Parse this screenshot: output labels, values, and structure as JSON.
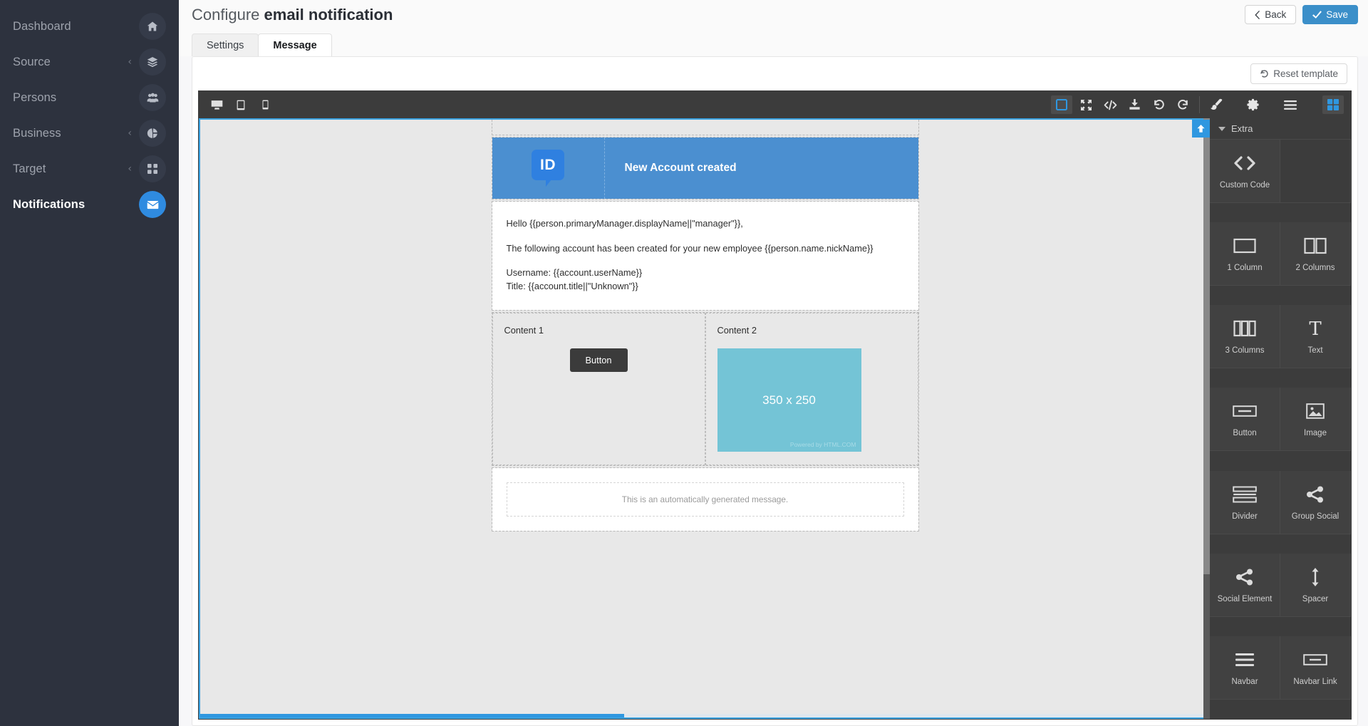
{
  "sidebar": {
    "items": [
      {
        "label": "Dashboard",
        "icon": "home-icon",
        "caret": false,
        "active": false
      },
      {
        "label": "Source",
        "icon": "layers-icon",
        "caret": true,
        "active": false
      },
      {
        "label": "Persons",
        "icon": "users-icon",
        "caret": false,
        "active": false
      },
      {
        "label": "Business",
        "icon": "pie-chart-icon",
        "caret": true,
        "active": false
      },
      {
        "label": "Target",
        "icon": "grid-icon",
        "caret": true,
        "active": false
      },
      {
        "label": "Notifications",
        "icon": "envelope-icon",
        "caret": false,
        "active": true
      }
    ],
    "caret_glyph": "‹",
    "active_color": "#2f8be0",
    "background": "#2d323e"
  },
  "header": {
    "title_prefix": "Configure ",
    "title_strong": "email notification",
    "back_label": "Back",
    "save_label": "Save",
    "save_color": "#3b8fc9"
  },
  "tabs": [
    {
      "label": "Settings",
      "active": false
    },
    {
      "label": "Message",
      "active": true
    }
  ],
  "card": {
    "reset_label": "Reset template"
  },
  "editor_toolbar": {
    "devices": [
      {
        "name": "desktop-view-icon",
        "active": false
      },
      {
        "name": "tablet-view-icon",
        "active": false
      },
      {
        "name": "mobile-view-icon",
        "active": false
      }
    ],
    "tools": [
      {
        "name": "borders-toggle-icon",
        "active": true
      },
      {
        "name": "fullscreen-icon",
        "active": false
      },
      {
        "name": "code-view-icon",
        "active": false
      },
      {
        "name": "import-icon",
        "active": false
      },
      {
        "name": "undo-icon",
        "active": false
      },
      {
        "name": "redo-icon",
        "active": false
      }
    ],
    "panels": [
      {
        "name": "paint-brush-icon",
        "active": false
      },
      {
        "name": "settings-gear-icon",
        "active": false
      },
      {
        "name": "layers-list-icon",
        "active": false
      },
      {
        "name": "blocks-icon",
        "active": true
      }
    ],
    "accent": "#2f97e0",
    "background": "#3c3c3c"
  },
  "email": {
    "header": {
      "logo_text": "ID",
      "title": "New Account created",
      "background": "#4b8fd0",
      "logo_color": "#2f80e0"
    },
    "body_lines": [
      "Hello {{person.primaryManager.displayName||\"manager\"}},",
      "The following account has been created for your new employee {{person.name.nickName}}",
      "Username: {{account.userName}}",
      "Title: {{account.title||\"Unknown\"}}"
    ],
    "columns": [
      {
        "label": "Content 1",
        "button_label": "Button"
      },
      {
        "label": "Content 2",
        "image_dim": "350 x 250",
        "image_credit": "Powered by HTML.COM"
      }
    ],
    "footer_text": "This is an automatically generated message.",
    "image_color": "#74c4d6",
    "button_color": "#3b3b3b"
  },
  "blocks_panel": {
    "section_title": "Extra",
    "blocks": [
      {
        "label": "Custom Code",
        "icon": "code-brackets-icon"
      },
      {
        "label": "1 Column",
        "icon": "one-column-icon"
      },
      {
        "label": "2 Columns",
        "icon": "two-columns-icon"
      },
      {
        "label": "3 Columns",
        "icon": "three-columns-icon"
      },
      {
        "label": "Text",
        "icon": "text-t-icon"
      },
      {
        "label": "Button",
        "icon": "button-icon"
      },
      {
        "label": "Image",
        "icon": "image-icon"
      },
      {
        "label": "Divider",
        "icon": "divider-icon"
      },
      {
        "label": "Group Social",
        "icon": "share-nodes-icon"
      },
      {
        "label": "Social Element",
        "icon": "share-nodes-icon"
      },
      {
        "label": "Spacer",
        "icon": "vertical-arrows-icon"
      },
      {
        "label": "Navbar",
        "icon": "hamburger-icon"
      },
      {
        "label": "Navbar Link",
        "icon": "navbar-link-icon"
      }
    ]
  }
}
